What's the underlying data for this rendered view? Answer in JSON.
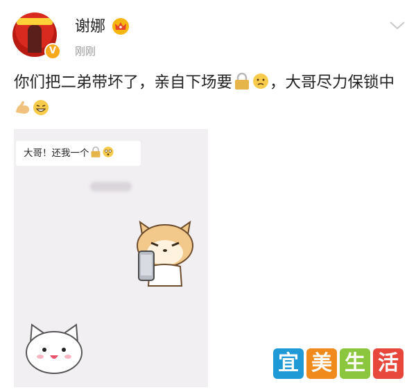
{
  "post": {
    "author": "谢娜",
    "time": "刚刚",
    "text_part1": "你们把二弟带坏了，亲自下场要",
    "text_part2": "，大哥尽力保锁中",
    "verified_mark": "V"
  },
  "screenshot": {
    "bubble_text": "大哥！还我一个"
  },
  "watermark": {
    "chars": [
      "宜",
      "美",
      "生",
      "活"
    ]
  },
  "icons": {
    "crown": "crown-icon",
    "chevron": "chevron-down-icon",
    "lock": "lock-icon",
    "sad_face": "sad-face-icon",
    "muscle": "flexed-biceps-icon",
    "grin": "grinning-face-icon",
    "flushed": "flushed-face-icon"
  },
  "colors": {
    "verified": "#f7a81b",
    "crown": "#f6b60f",
    "watermark": [
      "#1f9ad6",
      "#f08a1c",
      "#8cc63f",
      "#e8473b"
    ]
  }
}
